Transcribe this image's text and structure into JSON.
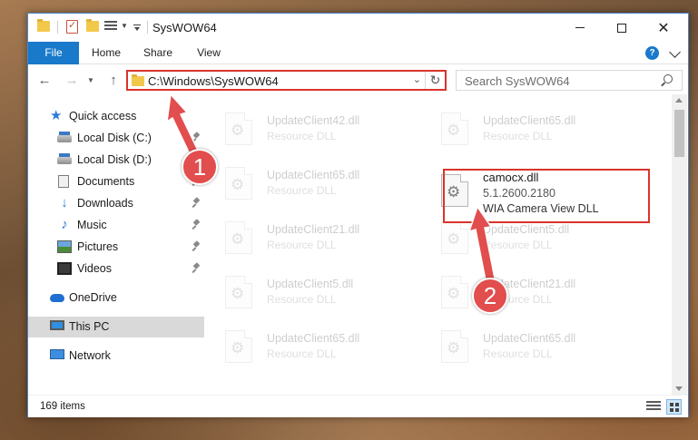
{
  "window": {
    "title": "SysWOW64"
  },
  "ribbon": {
    "tabs": [
      {
        "label": "File"
      },
      {
        "label": "Home"
      },
      {
        "label": "Share"
      },
      {
        "label": "View"
      }
    ]
  },
  "address": {
    "path": "C:\\Windows\\SysWOW64"
  },
  "search": {
    "placeholder": "Search SysWOW64"
  },
  "sidebar": {
    "items": [
      {
        "label": "Quick access",
        "icon": "quick-access-star-icon"
      },
      {
        "label": "Local Disk (C:)",
        "icon": "local-disk-icon"
      },
      {
        "label": "Local Disk (D:)",
        "icon": "local-disk-icon"
      },
      {
        "label": "Documents",
        "icon": "documents-icon"
      },
      {
        "label": "Downloads",
        "icon": "downloads-icon"
      },
      {
        "label": "Music",
        "icon": "music-icon"
      },
      {
        "label": "Pictures",
        "icon": "pictures-icon"
      },
      {
        "label": "Videos",
        "icon": "videos-icon"
      },
      {
        "label": "OneDrive",
        "icon": "onedrive-icon"
      },
      {
        "label": "This PC",
        "icon": "this-pc-icon"
      },
      {
        "label": "Network",
        "icon": "network-icon"
      }
    ]
  },
  "files": [
    {
      "name": "UpdateClient42.dll",
      "desc": "Resource DLL"
    },
    {
      "name": "UpdateClient65.dll",
      "desc": "Resource DLL"
    },
    {
      "name": "UpdateClient65.dll",
      "desc": "Resource DLL"
    },
    {
      "name": "camocx.dll",
      "version": "5.1.2600.2180",
      "desc": "WIA Camera View DLL"
    },
    {
      "name": "UpdateClient21.dll",
      "desc": "Resource DLL"
    },
    {
      "name": "UpdateClient5.dll",
      "desc": "Resource DLL"
    },
    {
      "name": "UpdateClient5.dll",
      "desc": "Resource DLL"
    },
    {
      "name": "UpdateClient21.dll",
      "desc": "Resource DLL"
    },
    {
      "name": "UpdateClient65.dll",
      "desc": "Resource DLL"
    },
    {
      "name": "UpdateClient65.dll",
      "desc": "Resource DLL"
    }
  ],
  "status": {
    "item_count": "169 items"
  },
  "annotations": {
    "step1": "1",
    "step2": "2",
    "color": "#e24d4d"
  }
}
